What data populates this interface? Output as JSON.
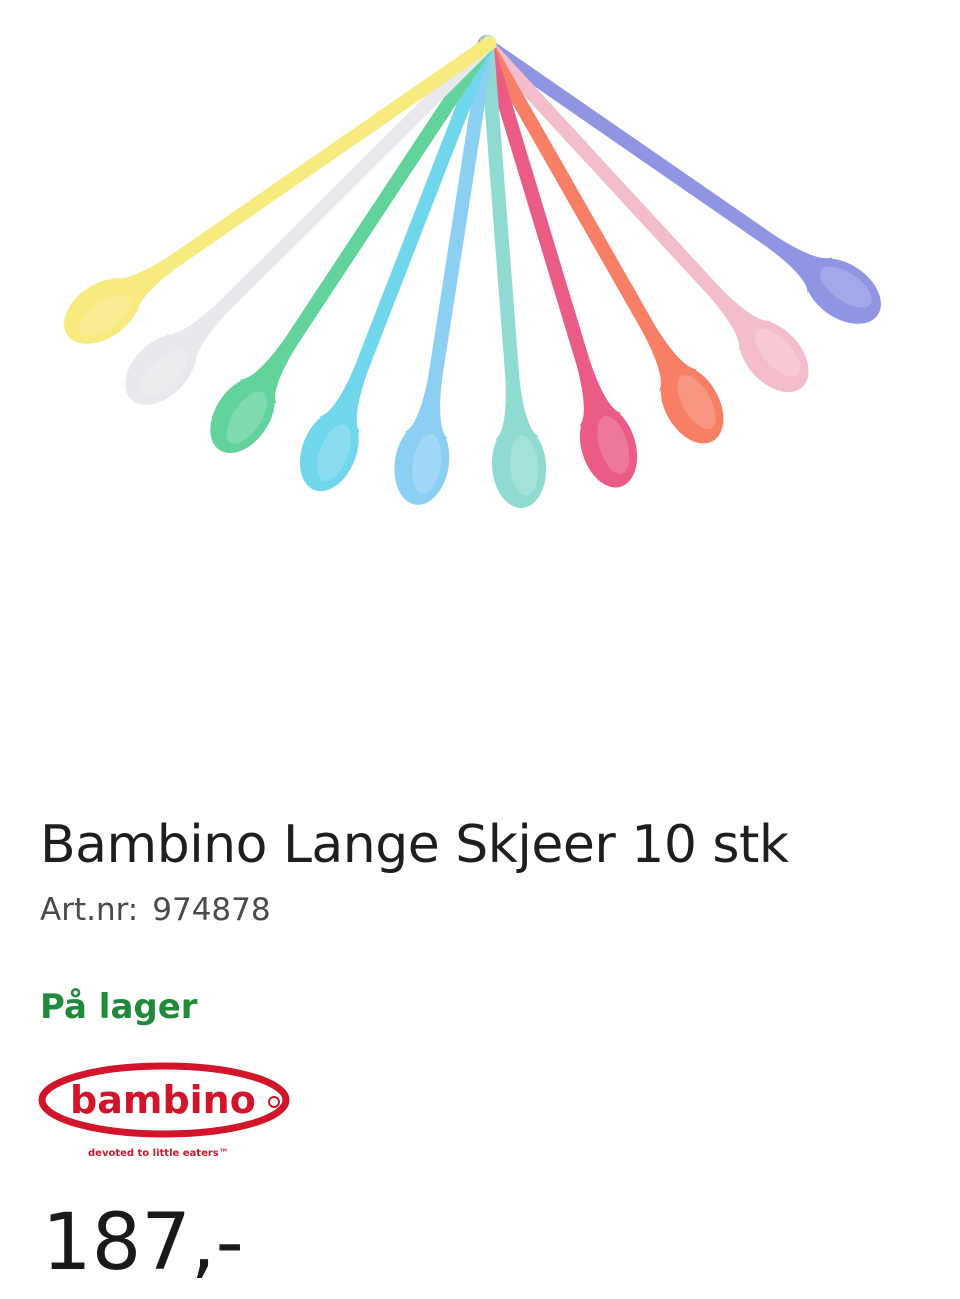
{
  "product": {
    "title": "Bambino Lange Skjeer 10 stk",
    "art_label": "Art.nr:",
    "art_number": "974878",
    "stock_status": "På lager",
    "price": "187,-"
  },
  "brand": {
    "name": "bambino",
    "tagline": "devoted to little eaters™"
  },
  "colors": {
    "stock_green": "#1f8a3a",
    "brand_red": "#d2152a",
    "spoons": [
      "#f7ea7e",
      "#e9e9ed",
      "#62d39b",
      "#6fd6ec",
      "#8bd0f3",
      "#8fdbd2",
      "#ea5b86",
      "#f77f66",
      "#f4bdcc",
      "#8f95e3"
    ]
  },
  "icons": {
    "product_image": "fan-of-spoons-image",
    "brand_logo": "bambino-logo"
  }
}
